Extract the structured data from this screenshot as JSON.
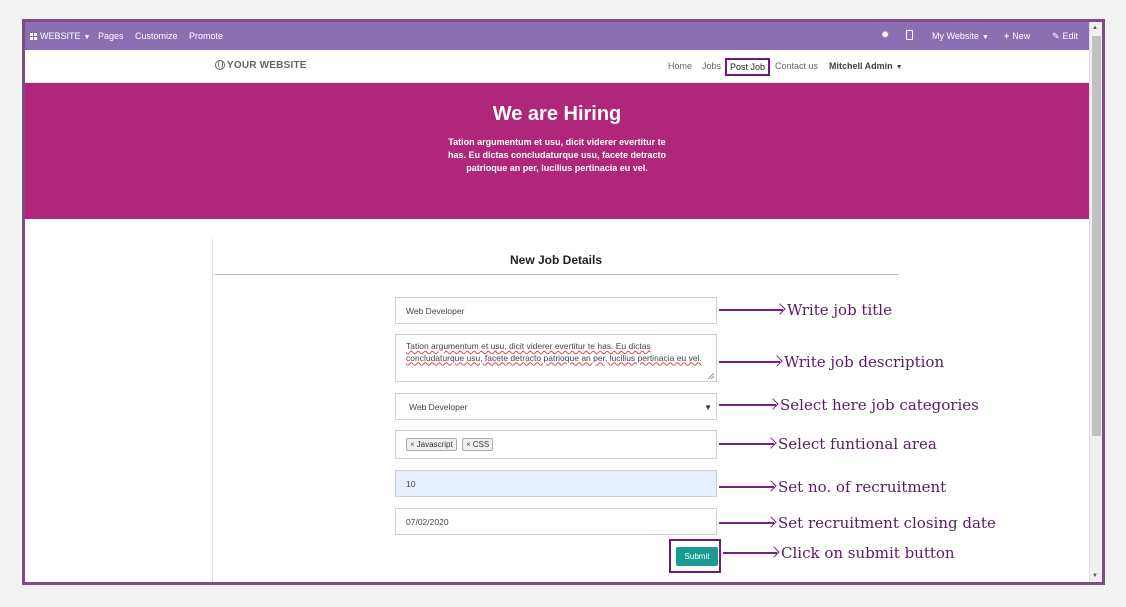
{
  "topbar": {
    "website": "WEBSITE",
    "pages": "Pages",
    "customize": "Customize",
    "promote": "Promote",
    "my_website": "My Website",
    "new": "New",
    "edit": "Edit"
  },
  "navbar": {
    "logo": "YOUR WEBSITE",
    "links": [
      "Home",
      "Jobs",
      "Post Job",
      "Contact us"
    ],
    "user": "Mitchell Admin"
  },
  "hero": {
    "title": "We are Hiring",
    "text": "Tation argumentum et usu, dicit viderer evertitur te has. Eu dictas concludaturque usu, facete detracto patrioque an per, lucilius pertinacia eu vel."
  },
  "form": {
    "title": "New Job Details",
    "job_title": "Web Developer",
    "description": "Tation argumentum et usu, dicit viderer evertitur te has. Eu dictas concludaturque usu, facete detracto patrioque an per, lucilius pertinacia eu vel.",
    "category": "Web Developer",
    "tags": [
      "Javascript",
      "CSS"
    ],
    "recruitment": "10",
    "closing_date": "07/02/2020",
    "submit": "Submit"
  },
  "annotations": [
    "Write job title",
    "Write job description",
    "Select here job categories",
    "Select funtional area",
    "Set no. of recruitment",
    "Set recruitment closing date",
    "Click on submit button"
  ],
  "colors": {
    "topbar": "#8a6fb3",
    "hero": "#b0267a",
    "submit": "#1a9b92",
    "annotation": "#5c1a66"
  }
}
